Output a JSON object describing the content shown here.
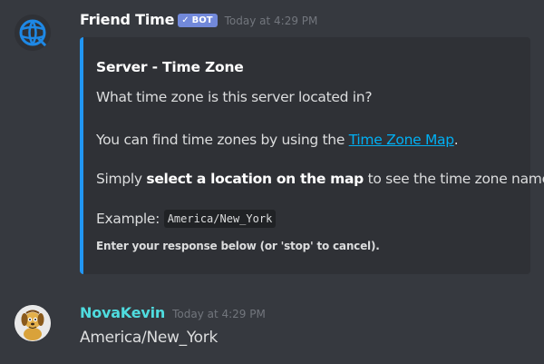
{
  "messages": {
    "bot": {
      "username": "Friend Time",
      "badge": "BOT",
      "timestamp": "Today at 4:29 PM",
      "embed": {
        "title": "Server - Time Zone",
        "question": "What time zone is this server located in?",
        "find_prefix": "You can find time zones by using the ",
        "find_link": "Time Zone Map",
        "find_suffix": ".",
        "simply_prefix": "Simply ",
        "simply_bold": "select a location on the map",
        "simply_suffix": " to see the time zone name.",
        "example_label": "Example: ",
        "example_code": "America/New_York",
        "footer": "Enter your response below (or 'stop' to cancel).",
        "accent_color": "#2196f3"
      }
    },
    "user": {
      "username": "NovaKevin",
      "timestamp": "Today at 4:29 PM",
      "text": "America/New_York",
      "name_color": "#4fdcdf"
    }
  },
  "icons": {
    "bot_avatar": "globe-icon",
    "badge_check": "checkmark-icon",
    "user_avatar": "cartoon-dog-icon"
  },
  "colors": {
    "background": "#36393f",
    "embed_bg": "#2f3136",
    "link": "#00b0f4",
    "badge": "#7289da"
  }
}
